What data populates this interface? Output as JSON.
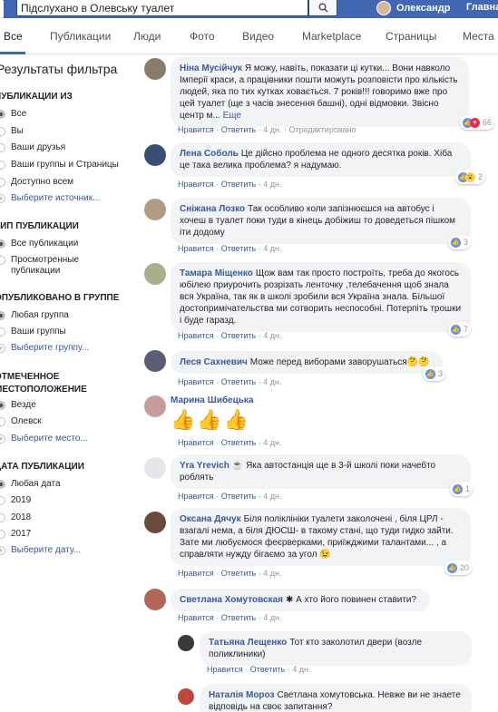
{
  "topbar": {
    "search_value": "Підслухано в Олевську туалет",
    "user_name": "Олександр",
    "home_label": "Главная"
  },
  "tabs": [
    "Все",
    "Публикации",
    "Люди",
    "Фото",
    "Видео",
    "Marketplace",
    "Страницы",
    "Места"
  ],
  "sidebar": {
    "title": "Результаты фильтра",
    "sections": [
      {
        "heading": "ПУБЛИКАЦИИ ИЗ",
        "items": [
          "Все",
          "Вы",
          "Ваши друзья",
          "Ваши группы и Страницы",
          "Доступно всем"
        ],
        "link": "Выберите источник..."
      },
      {
        "heading": "Тип публикации",
        "items": [
          "Все публикации",
          "Просмотренные публикации"
        ]
      },
      {
        "heading": "ОПУБЛИКОВАНО В ГРУППЕ",
        "items": [
          "Любая группа",
          "Ваши группы"
        ],
        "link": "Выберите группу..."
      },
      {
        "heading": "ОТМЕЧЕННОЕ МЕСТОПОЛОЖЕНИЕ",
        "items": [
          "Везде",
          "Олевск"
        ],
        "link": "Выберите место..."
      },
      {
        "heading": "ДАТА ПУБЛИКАЦИИ",
        "items": [
          "Любая дата",
          "2019",
          "2018",
          "2017"
        ],
        "link": "Выберите дату..."
      }
    ]
  },
  "comments": [
    {
      "author": "Ніна Мусійчук",
      "text": "Я можу, навіть, показати ці кутки... Вони навколо Імперії краси, а працівники пошти можуть розповісти про кількість людей, яка по тих кутках ховається. 7 років!!! говоримо вже про цей туалет (ще з часів знесення башні), одні відмовки. Звісно центр м...",
      "more": "Еще",
      "like": "Нравится",
      "reply": "Ответить",
      "time": "4 дн.",
      "edited": "Отредактировано",
      "reactions": "66"
    },
    {
      "author": "Лена Соболь",
      "text": "Це дійсно проблема не одного десятка років. Хіба це така велика проблема? я надумаю.",
      "like": "Нравится",
      "reply": "Ответить",
      "time": "4 дн.",
      "reactions": "2"
    },
    {
      "author": "Сніжана Лозко",
      "text": "Так особливо коли запізнюєшся на автобус і хочеш в туалет поки туди в кінець добіжиш то доведеться пішком іти додому",
      "like": "Нравится",
      "reply": "Ответить",
      "time": "4 дн.",
      "reactions": "3"
    },
    {
      "author": "Тамара Міщенко",
      "text": "Щож вам так просто построїть, треба до якогось юбілею приурочить розрізать ленточку ,телебачення щоб знала вся Україна, так як в школі зробили вся Україна знала. Більшої достопримічательства ми сотворить неспособні. Потерпіть трошки і буде гаразд.",
      "like": "Нравится",
      "reply": "Ответить",
      "time": "4 дн.",
      "reactions": "7"
    },
    {
      "author": "Леся Сахневич",
      "text": "Може перед виборами заворушаться🤔🤔",
      "like": "Нравится",
      "reply": "Ответить",
      "time": "4 дн.",
      "reactions": "3"
    },
    {
      "author": "Марина Шибецька",
      "text": "👍👍👍",
      "like": "Нравится",
      "reply": "Ответить",
      "time": "4 дн."
    },
    {
      "author": "Yra Yrevich",
      "text": "☕ Яка автостанція ще в 3-й школі поки начебто роблять",
      "like": "Нравится",
      "reply": "Ответить",
      "time": "4 дн.",
      "reactions": "1"
    },
    {
      "author": "Оксана Дячук",
      "text": "Біля поліклініки туалети заколочені , біля ЦРЛ - взагалі нема, а біля ДЮСШ- в такому стані, що туди гидко зайти. Зате ми любуємося феєрверками, приїжджими талантами... , а справляти нужду бігаємо за угол 😉",
      "like": "Нравится",
      "reply": "Ответить",
      "time": "4 дн.",
      "reactions": "20"
    },
    {
      "author": "Светлана Хомутовская",
      "text": "✱ А хто його повинен ставити?",
      "like": "Нравится",
      "reply": "Ответить",
      "time": "4 дн."
    }
  ],
  "replies": [
    {
      "author": "Татьяна Лещенко",
      "text": "Тот кто заколотил двери (возле поликлиники)",
      "like": "Нравится",
      "reply": "Ответить",
      "time": "4 дн."
    },
    {
      "author": "Наталія Мороз",
      "text": "Светлана хомутовська. Невже ви не знаете відповідь на своє запитання?"
    }
  ],
  "colors": {
    "brand": "#4267b2",
    "link": "#385898",
    "bubble": "#f2f3f5"
  }
}
